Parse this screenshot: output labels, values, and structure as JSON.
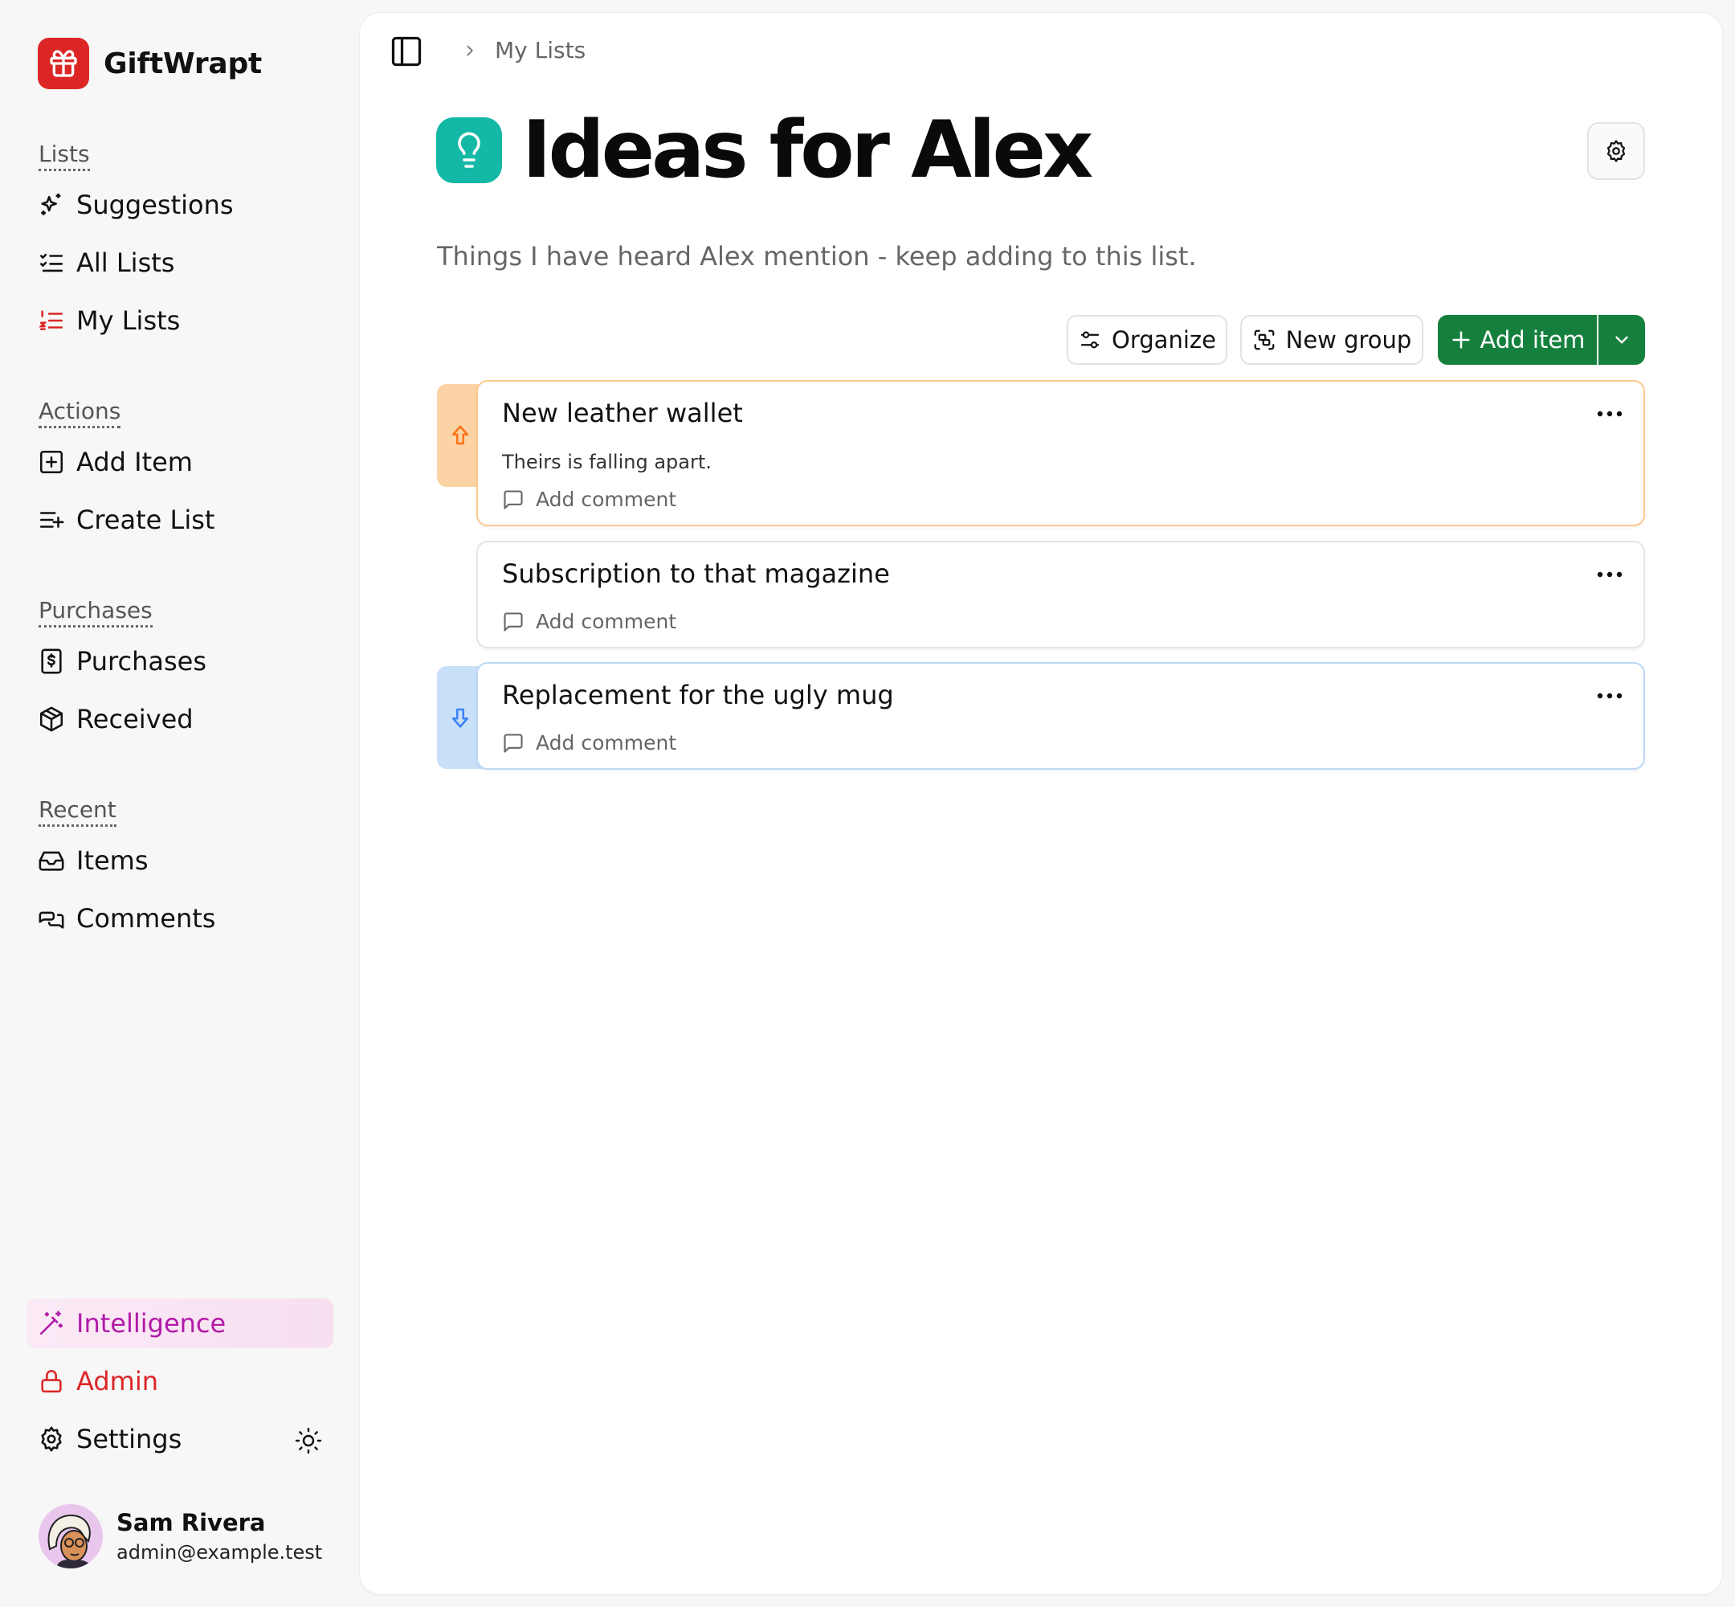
{
  "app": {
    "name": "GiftWrapt"
  },
  "sidebar": {
    "sections": [
      {
        "heading": "Lists",
        "items": [
          {
            "label": "Suggestions",
            "icon": "sparkles-icon"
          },
          {
            "label": "All Lists",
            "icon": "list-checks-icon"
          },
          {
            "label": "My Lists",
            "icon": "list-ordered-icon"
          }
        ]
      },
      {
        "heading": "Actions",
        "items": [
          {
            "label": "Add Item",
            "icon": "square-plus-icon"
          },
          {
            "label": "Create List",
            "icon": "list-plus-icon"
          }
        ]
      },
      {
        "heading": "Purchases",
        "items": [
          {
            "label": "Purchases",
            "icon": "receipt-icon"
          },
          {
            "label": "Received",
            "icon": "package-icon"
          }
        ]
      },
      {
        "heading": "Recent",
        "items": [
          {
            "label": "Items",
            "icon": "inbox-icon"
          },
          {
            "label": "Comments",
            "icon": "messages-icon"
          }
        ]
      }
    ],
    "bottom": {
      "intelligence": "Intelligence",
      "admin": "Admin",
      "settings": "Settings"
    },
    "user": {
      "name": "Sam Rivera",
      "email": "admin@example.test"
    }
  },
  "breadcrumb": {
    "current": "My Lists"
  },
  "list": {
    "title": "Ideas for Alex",
    "icon": "lightbulb-icon",
    "description": "Things I have heard Alex mention - keep adding to this list.",
    "toolbar": {
      "organize": "Organize",
      "new_group": "New group",
      "add_item": "Add item"
    },
    "items": [
      {
        "title": "New leather wallet",
        "note": "Theirs is falling apart.",
        "comment_label": "Add comment",
        "priority": "high"
      },
      {
        "title": "Subscription to that magazine",
        "note": "",
        "comment_label": "Add comment",
        "priority": "normal"
      },
      {
        "title": "Replacement for the ugly mug",
        "note": "",
        "comment_label": "Add comment",
        "priority": "low"
      }
    ]
  },
  "colors": {
    "brand": "#dc2626",
    "primary_button": "#15803d",
    "list_icon": "#14b8a6",
    "priority_high": "#f97316",
    "priority_low": "#3b82f6",
    "intelligence": "#b01aa8"
  }
}
